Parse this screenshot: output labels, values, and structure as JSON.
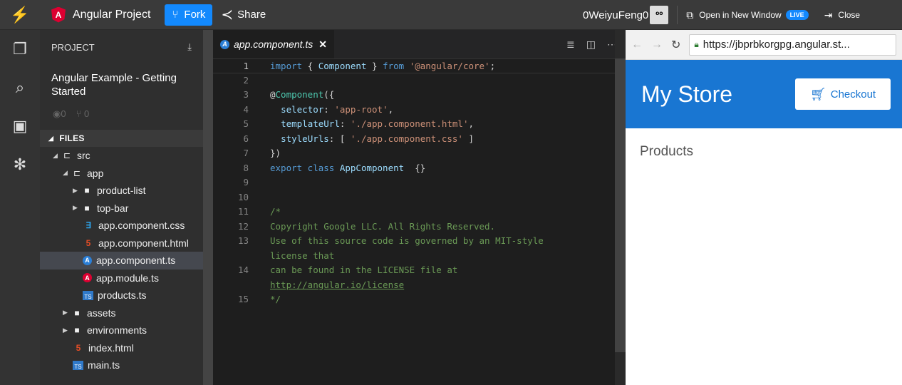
{
  "topbar": {
    "project_name": "Angular Project",
    "fork_label": "Fork",
    "share_label": "Share",
    "username": "0WeiyuFeng0",
    "open_window_label": "Open in New Window",
    "live_badge": "LIVE",
    "close_label": "Close"
  },
  "sidebar": {
    "header": "PROJECT",
    "project_title": "Angular Example - Getting Started",
    "views": "0",
    "forks": "0",
    "files_header": "FILES",
    "tree": [
      {
        "label": "src",
        "depth": 0,
        "type": "folder",
        "expanded": true
      },
      {
        "label": "app",
        "depth": 1,
        "type": "folder",
        "expanded": true
      },
      {
        "label": "product-list",
        "depth": 2,
        "type": "folder",
        "expanded": false
      },
      {
        "label": "top-bar",
        "depth": 2,
        "type": "folder",
        "expanded": false
      },
      {
        "label": "app.component.css",
        "depth": 2,
        "type": "css"
      },
      {
        "label": "app.component.html",
        "depth": 2,
        "type": "html"
      },
      {
        "label": "app.component.ts",
        "depth": 2,
        "type": "ng-ts",
        "selected": true
      },
      {
        "label": "app.module.ts",
        "depth": 2,
        "type": "ng"
      },
      {
        "label": "products.ts",
        "depth": 2,
        "type": "ts"
      },
      {
        "label": "assets",
        "depth": 1,
        "type": "folder",
        "expanded": false
      },
      {
        "label": "environments",
        "depth": 1,
        "type": "folder",
        "expanded": false
      },
      {
        "label": "index.html",
        "depth": 1,
        "type": "html"
      },
      {
        "label": "main.ts",
        "depth": 1,
        "type": "ts"
      }
    ]
  },
  "editor": {
    "tab_label": "app.component.ts",
    "close_glyph": "✕",
    "current_line": 1,
    "lines": [
      {
        "n": "1",
        "html": "<span class=\"k\">import</span> { <span class=\"p\">Component</span> } <span class=\"k\">from</span> <span class=\"s\">'@angular/core'</span>;"
      },
      {
        "n": "2",
        "html": ""
      },
      {
        "n": "3",
        "html": "@<span class=\"t\">Component</span>({"
      },
      {
        "n": "4",
        "html": "  <span class=\"p\">selector</span>: <span class=\"s\">'app-root'</span>,"
      },
      {
        "n": "5",
        "html": "  <span class=\"p\">templateUrl</span>: <span class=\"s\">'./app.component.html'</span>,"
      },
      {
        "n": "6",
        "html": "  <span class=\"p\">styleUrls</span>: [ <span class=\"s\">'./app.component.css'</span> ]"
      },
      {
        "n": "7",
        "html": "})"
      },
      {
        "n": "8",
        "html": "<span class=\"k\">export class</span> <span class=\"p\">AppComponent</span>  {}"
      },
      {
        "n": "9",
        "html": ""
      },
      {
        "n": "10",
        "html": ""
      },
      {
        "n": "11",
        "html": "<span class=\"c\">/*</span>"
      },
      {
        "n": "12",
        "html": "<span class=\"c\">Copyright Google LLC. All Rights Reserved.</span>"
      },
      {
        "n": "13",
        "html": "<span class=\"c\">Use of this source code is governed by an MIT-style</span>"
      },
      {
        "n": "",
        "html": "<span class=\"c\">license that</span>"
      },
      {
        "n": "14",
        "html": "<span class=\"c\">can be found in the LICENSE file at</span>"
      },
      {
        "n": "",
        "html": "<span class=\"u\">http://angular.io/license</span>"
      },
      {
        "n": "15",
        "html": "<span class=\"c\">*/</span>"
      }
    ]
  },
  "preview": {
    "url": "https://jbprbkorgpg.angular.st...",
    "store_title": "My Store",
    "checkout_label": "Checkout",
    "products_heading": "Products"
  },
  "colors": {
    "accent": "#1389fd",
    "store_header": "#1976d2",
    "angular_red": "#dd0031"
  }
}
